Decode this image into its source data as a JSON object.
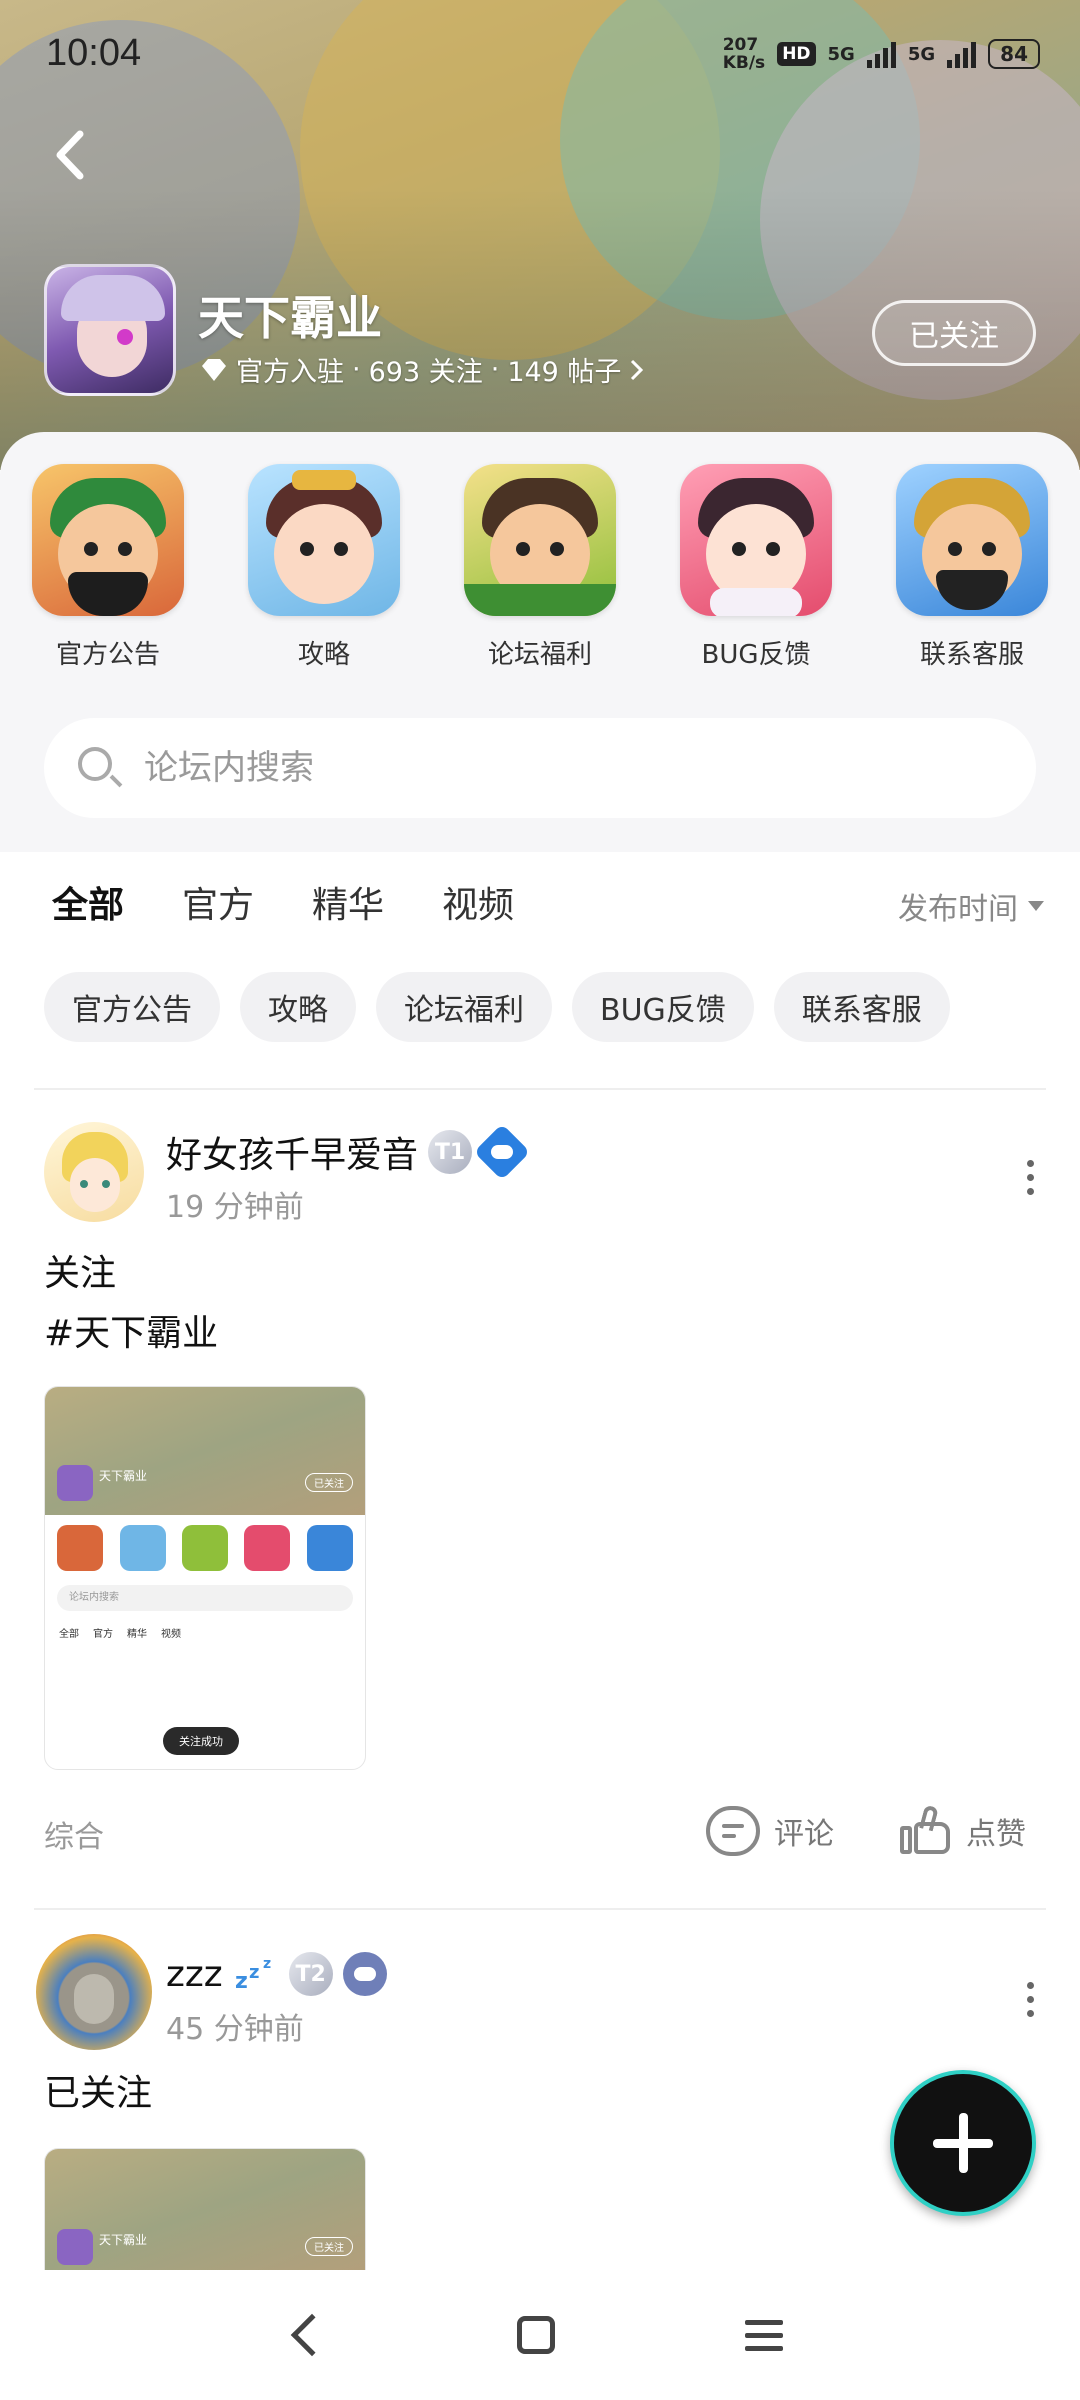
{
  "status_bar": {
    "time": "10:04",
    "speed_top": "207",
    "speed_bottom": "KB/s",
    "hd": "HD",
    "net1": "5G",
    "net2": "5G",
    "battery": "84"
  },
  "header": {
    "forum_title": "天下霸业",
    "meta_official": "官方入驻",
    "meta_followers": "693 关注",
    "meta_posts": "149 帖子",
    "follow_label": "已关注"
  },
  "categories": [
    {
      "label": "官方公告",
      "color": "#d9673a"
    },
    {
      "label": "攻略",
      "color": "#6fb6e6"
    },
    {
      "label": "论坛福利",
      "color": "#8fbf3a"
    },
    {
      "label": "BUG反馈",
      "color": "#e44c6d"
    },
    {
      "label": "联系客服",
      "color": "#3a86d9"
    }
  ],
  "search": {
    "placeholder": "论坛内搜索"
  },
  "tabs": [
    {
      "label": "全部",
      "active": true
    },
    {
      "label": "官方"
    },
    {
      "label": "精华"
    },
    {
      "label": "视频"
    }
  ],
  "sort_label": "发布时间",
  "chips": [
    "官方公告",
    "攻略",
    "论坛福利",
    "BUG反馈",
    "联系客服"
  ],
  "posts": [
    {
      "author": "好女孩千早爱音",
      "level": "T1",
      "time": "19 分钟前",
      "lines": [
        "关注",
        "#天下霸业"
      ],
      "thumb": {
        "title": "天下霸业",
        "follow": "已关注",
        "search": "论坛内搜索",
        "tabs": [
          "全部",
          "官方",
          "精华",
          "视频"
        ],
        "toast": "关注成功"
      },
      "category": "综合",
      "comment_label": "评论",
      "like_label": "点赞"
    },
    {
      "author": "zzz",
      "level": "T2",
      "time": "45 分钟前",
      "lines": [
        "已关注"
      ],
      "thumb": {
        "title": "天下霸业",
        "follow": "已关注"
      }
    }
  ],
  "colors": {
    "accent": "#35d1b4",
    "fab": "#111111"
  }
}
